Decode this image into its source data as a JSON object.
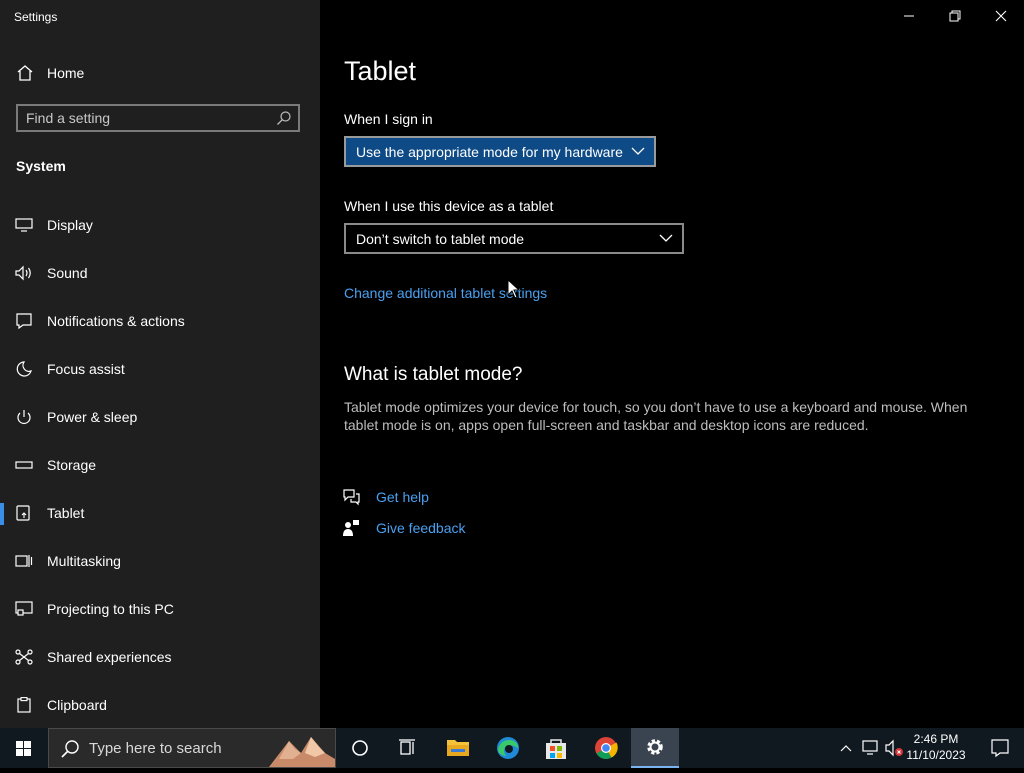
{
  "window": {
    "title": "Settings"
  },
  "sidebar": {
    "home_label": "Home",
    "search_placeholder": "Find a setting",
    "section": "System",
    "items": [
      {
        "label": "Display",
        "icon": "monitor-icon"
      },
      {
        "label": "Sound",
        "icon": "speaker-icon"
      },
      {
        "label": "Notifications & actions",
        "icon": "notification-icon"
      },
      {
        "label": "Focus assist",
        "icon": "moon-icon"
      },
      {
        "label": "Power & sleep",
        "icon": "power-icon"
      },
      {
        "label": "Storage",
        "icon": "storage-icon"
      },
      {
        "label": "Tablet",
        "icon": "tablet-icon",
        "active": true
      },
      {
        "label": "Multitasking",
        "icon": "multitasking-icon"
      },
      {
        "label": "Projecting to this PC",
        "icon": "projecting-icon"
      },
      {
        "label": "Shared experiences",
        "icon": "shared-icon"
      },
      {
        "label": "Clipboard",
        "icon": "clipboard-icon"
      }
    ]
  },
  "main": {
    "title": "Tablet",
    "sign_in_label": "When I sign in",
    "sign_in_value": "Use the appropriate mode for my hardware",
    "tablet_label": "When I use this device as a tablet",
    "tablet_value": "Don’t switch to tablet mode",
    "additional_link": "Change additional tablet settings",
    "what_heading": "What is tablet mode?",
    "what_text": "Tablet mode optimizes your device for touch, so you don’t have to use a keyboard and mouse. When tablet mode is on, apps open full-screen and taskbar and desktop icons are reduced.",
    "get_help": "Get help",
    "give_feedback": "Give feedback"
  },
  "taskbar": {
    "search_placeholder": "Type here to search",
    "time": "2:46 PM",
    "date": "11/10/2023"
  },
  "colors": {
    "accent": "#3a8ee6",
    "link": "#4aa0f0",
    "dropdown_primary": "#0d4a86",
    "sidebar_bg": "#1f1f1f"
  }
}
